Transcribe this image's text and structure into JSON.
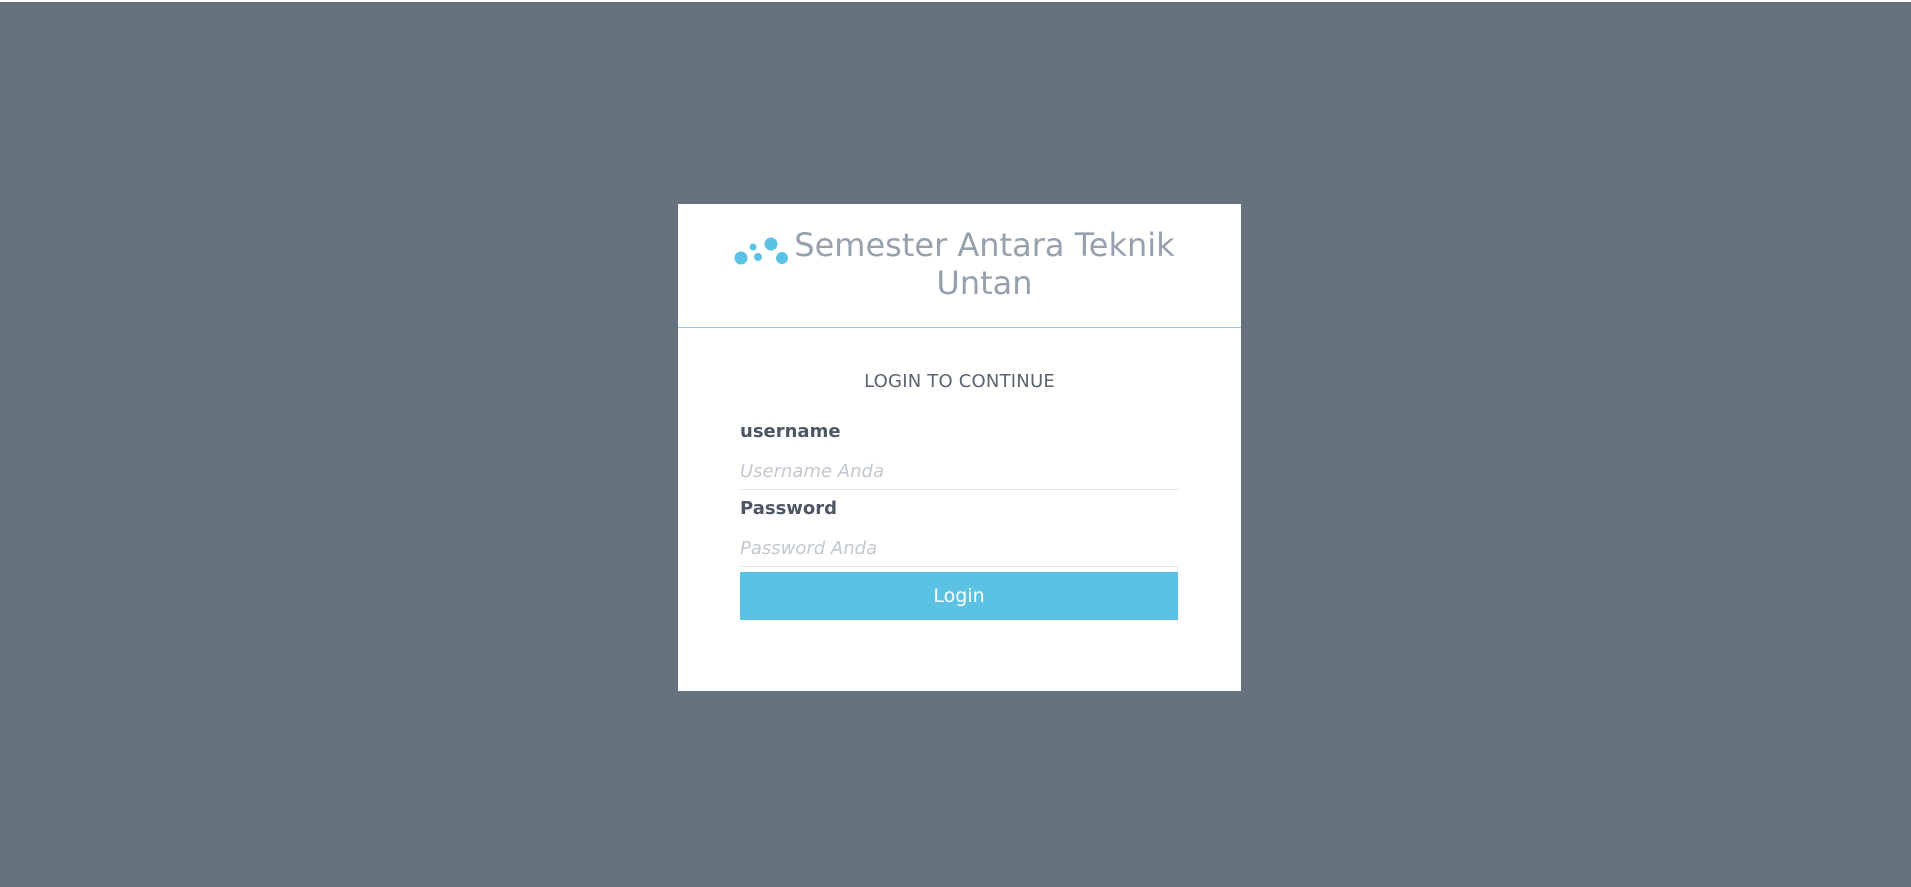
{
  "brand": {
    "title": "Semester Antara Teknik Untan",
    "logo_icon": "dots-logo-icon",
    "logo_color": "#5bc2e4"
  },
  "form": {
    "heading": "LOGIN TO CONTINUE",
    "username": {
      "label": "username",
      "placeholder": "Username Anda",
      "value": ""
    },
    "password": {
      "label": "Password",
      "placeholder": "Password Anda",
      "value": ""
    },
    "submit_label": "Login"
  },
  "colors": {
    "background": "#67727f",
    "accent": "#5bc2e4",
    "title_text": "#97a1ae"
  }
}
